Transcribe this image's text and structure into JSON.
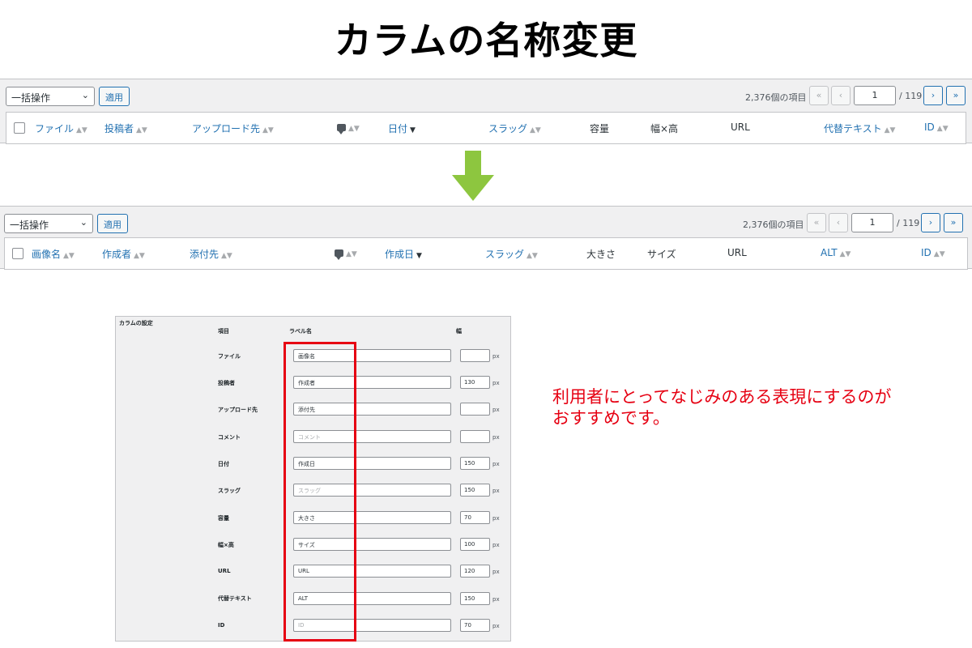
{
  "title": "カラムの名称変更",
  "toolbar": {
    "bulk_label": "一括操作",
    "apply_label": "適用",
    "item_count": "2,376個の項目",
    "first": "«",
    "prev": "‹",
    "page": "1",
    "total": "/ 119",
    "next": "›",
    "last": "»"
  },
  "sort_glyph": "▲▼",
  "sort_down": "▼",
  "before_columns": [
    "ファイル",
    "投稿者",
    "アップロード先",
    "",
    "日付",
    "スラッグ",
    "容量",
    "幅×高",
    "URL",
    "代替テキスト",
    "ID"
  ],
  "after_columns": [
    "画像名",
    "作成者",
    "添付先",
    "",
    "作成日",
    "スラッグ",
    "大きさ",
    "サイズ",
    "URL",
    "ALT",
    "ID"
  ],
  "settings": {
    "heading": "カラムの設定",
    "col_item": "項目",
    "col_label": "ラベル名",
    "col_width": "幅",
    "unit": "px",
    "rows": [
      {
        "name": "ファイル",
        "label": "画像名",
        "width": ""
      },
      {
        "name": "投稿者",
        "label": "作成者",
        "width": "130"
      },
      {
        "name": "アップロード先",
        "label": "添付先",
        "width": ""
      },
      {
        "name": "コメント",
        "label": "コメント",
        "width": ""
      },
      {
        "name": "日付",
        "label": "作成日",
        "width": "150"
      },
      {
        "name": "スラッグ",
        "label": "スラッグ",
        "width": "150"
      },
      {
        "name": "容量",
        "label": "大きさ",
        "width": "70"
      },
      {
        "name": "幅×高",
        "label": "サイズ",
        "width": "100"
      },
      {
        "name": "URL",
        "label": "URL",
        "width": "120"
      },
      {
        "name": "代替テキスト",
        "label": "ALT",
        "width": "150"
      },
      {
        "name": "ID",
        "label": "ID",
        "width": "70"
      }
    ]
  },
  "note": "利用者にとってなじみのある表現にするのがおすすめです。",
  "colors": {
    "accent": "#2271b1",
    "arrow": "#8dc63f",
    "highlight": "#e60012"
  }
}
